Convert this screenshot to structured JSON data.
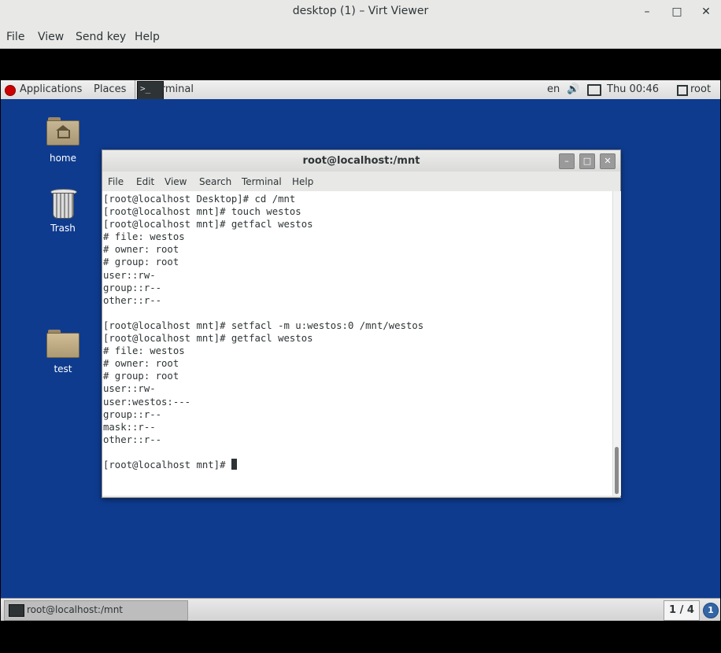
{
  "viewer": {
    "title": "desktop (1) – Virt Viewer",
    "menu": [
      "File",
      "View",
      "Send key",
      "Help"
    ],
    "controls": {
      "minimize": "–",
      "maximize": "□",
      "close": "✕"
    }
  },
  "top_panel": {
    "applications": "Applications",
    "places": "Places",
    "task": "Terminal",
    "keyboard": "en",
    "clock": "Thu 00:46",
    "user": "root"
  },
  "desktop_icons": [
    {
      "label": "home"
    },
    {
      "label": "Trash"
    },
    {
      "label": "test"
    }
  ],
  "terminal": {
    "title": "root@localhost:/mnt",
    "menu": [
      "File",
      "Edit",
      "View",
      "Search",
      "Terminal",
      "Help"
    ],
    "lines": [
      "[root@localhost Desktop]# cd /mnt",
      "[root@localhost mnt]# touch westos",
      "[root@localhost mnt]# getfacl westos",
      "# file: westos",
      "# owner: root",
      "# group: root",
      "user::rw-",
      "group::r--",
      "other::r--",
      "",
      "[root@localhost mnt]# setfacl -m u:westos:0 /mnt/westos",
      "[root@localhost mnt]# getfacl westos",
      "# file: westos",
      "# owner: root",
      "# group: root",
      "user::rw-",
      "user:westos:---",
      "group::r--",
      "mask::r--",
      "other::r--",
      ""
    ],
    "prompt": "[root@localhost mnt]# "
  },
  "bottom_panel": {
    "task": "root@localhost:/mnt",
    "workspace": "1 / 4",
    "notifications": "1"
  },
  "colors": {
    "desktop": "#0e3b8e",
    "panel": "#dcdcdc",
    "accent": "#3465a4"
  }
}
